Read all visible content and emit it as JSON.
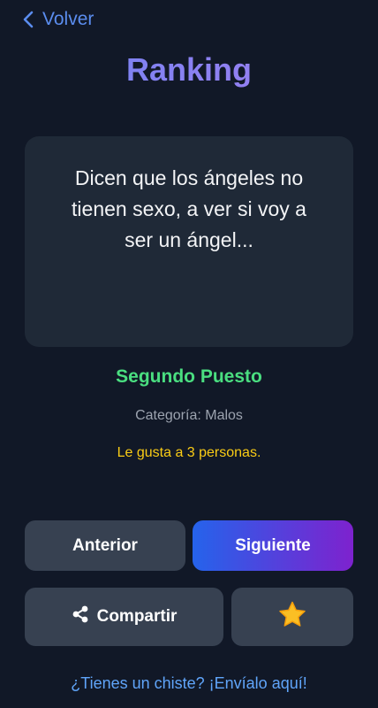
{
  "nav": {
    "back_label": "Volver"
  },
  "header": {
    "title": "Ranking"
  },
  "card": {
    "joke": "Dicen que los ángeles no tienen sexo, a ver si voy a ser un ángel..."
  },
  "info": {
    "place": "Segundo Puesto",
    "category": "Categoría: Malos",
    "likes": "Le gusta a 3 personas."
  },
  "actions": {
    "prev_label": "Anterior",
    "next_label": "Siguiente",
    "share_label": "Compartir",
    "share_icon": "share-icon",
    "favorite_icon": "star-icon"
  },
  "footer": {
    "submit_link": "¿Tienes un chiste? ¡Envíalo aquí!"
  },
  "colors": {
    "background": "#111827",
    "card": "#1f2937",
    "button": "#374151",
    "accent_green": "#4ade80",
    "accent_yellow": "#facc15",
    "link_blue": "#60a5fa",
    "gradient_start": "#2563eb",
    "gradient_end": "#7e22ce"
  }
}
